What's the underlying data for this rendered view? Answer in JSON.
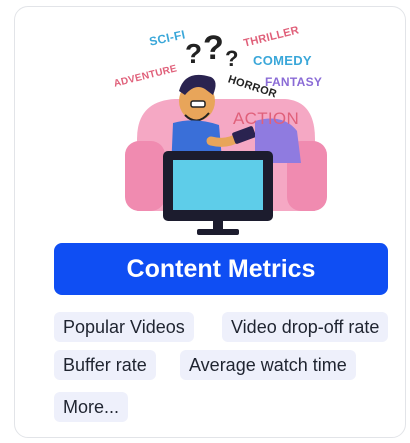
{
  "illustration": {
    "genres": {
      "scifi": "SCI-FI",
      "thriller": "THRILLER",
      "adventure": "ADVENTURE",
      "comedy": "COMEDY",
      "fantasy": "FANTASY",
      "horror": "HORROR",
      "action": "ACTION"
    },
    "colors": {
      "scifi": "#3aa7d9",
      "thriller": "#e0607a",
      "adventure": "#e0607a",
      "comedy": "#3aa7d9",
      "fantasy": "#8a6bd6",
      "horror": "#222222",
      "action": "#e0607a"
    }
  },
  "primary_button": {
    "label": "Content Metrics"
  },
  "chips": [
    {
      "label": "Popular Videos"
    },
    {
      "label": "Video drop-off rate"
    },
    {
      "label": "Buffer rate"
    },
    {
      "label": "Average watch time"
    },
    {
      "label": "More..."
    }
  ],
  "theme": {
    "accent": "#0f4ef3",
    "chip_bg": "#eef0fb"
  }
}
